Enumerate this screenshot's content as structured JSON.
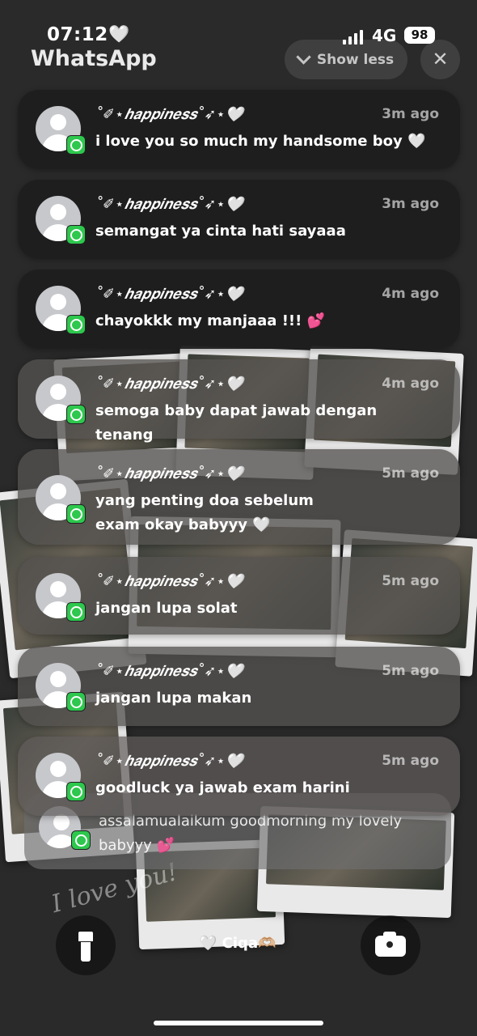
{
  "status_bar": {
    "time": "07:12",
    "time_emoji": "🤍",
    "network": "4G",
    "battery": "98"
  },
  "app": {
    "title": "WhatsApp",
    "show_less": "Show less",
    "close": "✕"
  },
  "notifications": [
    {
      "sender": "˚✐⋆𝒉𝒂𝒑𝒑𝒊𝒏𝒆𝒔𝒔˚➶⋆🤍",
      "time": "3m ago",
      "message": "i love you so much my handsome boy 🤍"
    },
    {
      "sender": "˚✐⋆𝒉𝒂𝒑𝒑𝒊𝒏𝒆𝒔𝒔˚➶⋆🤍",
      "time": "3m ago",
      "message": "semangat ya cinta hati sayaaa"
    },
    {
      "sender": "˚✐⋆𝒉𝒂𝒑𝒑𝒊𝒏𝒆𝒔𝒔˚➶⋆🤍",
      "time": "4m ago",
      "message": "chayokkk my manjaaa !!! 💕"
    },
    {
      "sender": "˚✐⋆𝒉𝒂𝒑𝒑𝒊𝒏𝒆𝒔𝒔˚➶⋆🤍",
      "time": "4m ago",
      "message": "semoga baby dapat jawab dengan tenang"
    },
    {
      "sender": "˚✐⋆𝒉𝒂𝒑𝒑𝒊𝒏𝒆𝒔𝒔˚➶⋆🤍",
      "time": "5m ago",
      "message": "yang penting doa sebelum exam okay babyyy 🤍"
    },
    {
      "sender": "˚✐⋆𝒉𝒂𝒑𝒑𝒊𝒏𝒆𝒔𝒔˚➶⋆🤍",
      "time": "5m ago",
      "message": "jangan lupa solat"
    },
    {
      "sender": "˚✐⋆𝒉𝒂𝒑𝒑𝒊𝒏𝒆𝒔𝒔˚➶⋆🤍",
      "time": "5m ago",
      "message": "jangan lupa makan"
    },
    {
      "sender": "˚✐⋆𝒉𝒂𝒑𝒑𝒊𝒏𝒆𝒔𝒔˚➶⋆🤍",
      "time": "5m ago",
      "message": "goodluck ya jawab exam harini"
    }
  ],
  "stacked_notification": {
    "message": "assalamualaikum goodmorning my lovely babyyy 💕"
  },
  "wallpaper": {
    "scrawl": "I love you!"
  },
  "bottom": {
    "owner": "🤍 Ciqa🫶🏼"
  },
  "icons": {
    "flashlight": "flashlight-icon",
    "camera": "camera-icon",
    "chevron": "chevron-down-icon",
    "close": "close-icon",
    "whatsapp": "whatsapp-badge-icon"
  },
  "colors": {
    "whatsapp_green": "#2dc84d",
    "card_dark": "#1e1e1e"
  }
}
